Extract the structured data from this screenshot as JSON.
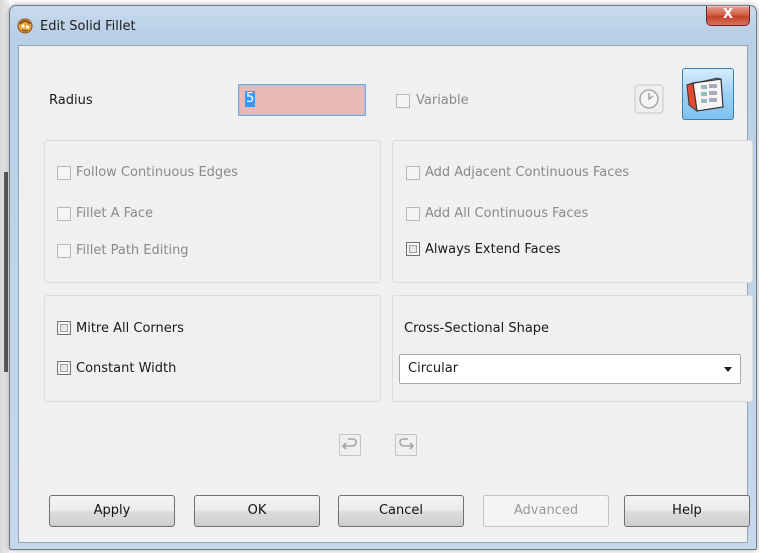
{
  "window": {
    "title": "Edit Solid Fillet",
    "close_label": "X"
  },
  "radius": {
    "label": "Radius",
    "value": "5"
  },
  "variable": {
    "label": "Variable",
    "checked": false,
    "enabled": false
  },
  "edges_panel": {
    "follow_continuous_edges": "Follow Continuous Edges",
    "fillet_a_face": "Fillet A Face",
    "fillet_path_editing": "Fillet Path Editing"
  },
  "faces_panel": {
    "add_adjacent_continuous_faces": "Add Adjacent Continuous Faces",
    "add_all_continuous_faces": "Add All Continuous Faces",
    "always_extend_faces": "Always Extend Faces"
  },
  "corners_panel": {
    "mitre_all_corners": "Mitre All Corners",
    "constant_width": "Constant Width"
  },
  "shape_panel": {
    "label": "Cross-Sectional Shape",
    "selected": "Circular"
  },
  "buttons": {
    "apply": "Apply",
    "ok": "OK",
    "cancel": "Cancel",
    "advanced": "Advanced",
    "help": "Help"
  },
  "icons": {
    "app": "fillet-app-icon",
    "history": "clock-icon",
    "tool": "fillet-tool-icon",
    "undo": "undo-icon",
    "redo": "redo-icon"
  },
  "colors": {
    "radius_field_bg": "#e9b9b5",
    "title_bar": "#b9cfe6",
    "close_button": "#c2412b",
    "dialog_bg": "#f0f0f0"
  }
}
